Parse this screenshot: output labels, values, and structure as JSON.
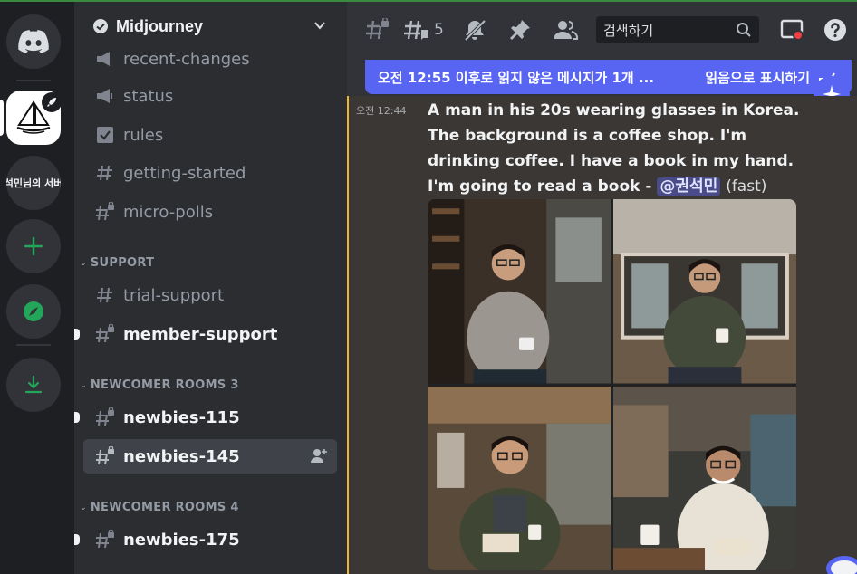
{
  "rail": {
    "server_text": "석민님의 서버"
  },
  "sidebar": {
    "guild_name": "Midjourney",
    "channels_top": [
      {
        "name": "recent-changes"
      },
      {
        "name": "status"
      },
      {
        "name": "rules"
      },
      {
        "name": "getting-started"
      },
      {
        "name": "micro-polls"
      }
    ],
    "support_category": "SUPPORT",
    "support_channels": [
      {
        "name": "trial-support"
      },
      {
        "name": "member-support"
      }
    ],
    "newcomer3_category": "NEWCOMER ROOMS 3",
    "newcomer3_channels": [
      {
        "name": "newbies-115"
      },
      {
        "name": "newbies-145"
      }
    ],
    "newcomer4_category": "NEWCOMER ROOMS 4",
    "newcomer4_channels": [
      {
        "name": "newbies-175"
      }
    ]
  },
  "toolbar": {
    "thread_count": "5",
    "search_placeholder": "검색하기"
  },
  "unread_bar": {
    "text": "오전 12:55 이후로 읽지 않은 메시지가 1개 ...",
    "mark_read": "읽음으로 표시하기"
  },
  "message": {
    "timestamp": "오전 12:44",
    "prompt": "A man in his 20s wearing glasses in Korea. The background is a coffee shop. I'm drinking coffee. I have a book in my hand. I'm going to read a book - ",
    "mention": "@권석민",
    "mode": "(fast)"
  },
  "colors": {
    "accent": "#5865f2",
    "highlight_bar": "#f0b232",
    "green": "#23a55a"
  }
}
